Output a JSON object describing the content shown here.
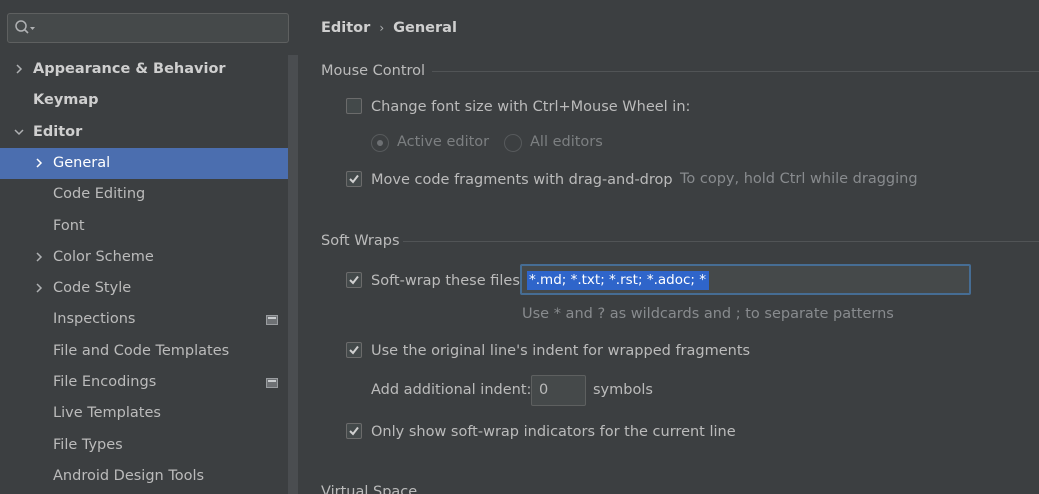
{
  "sidebar": {
    "search": {
      "value": "",
      "placeholder": ""
    },
    "items": [
      {
        "label": "Appearance & Behavior",
        "level": 0,
        "bold": true,
        "expandable": true,
        "expanded": false
      },
      {
        "label": "Keymap",
        "level": 0,
        "bold": true,
        "expandable": false
      },
      {
        "label": "Editor",
        "level": 0,
        "bold": true,
        "expandable": true,
        "expanded": true
      },
      {
        "label": "General",
        "level": 1,
        "expandable": true,
        "expanded": false,
        "selected": true
      },
      {
        "label": "Code Editing",
        "level": 1,
        "expandable": false
      },
      {
        "label": "Font",
        "level": 1,
        "expandable": false
      },
      {
        "label": "Color Scheme",
        "level": 1,
        "expandable": true,
        "expanded": false
      },
      {
        "label": "Code Style",
        "level": 1,
        "expandable": true,
        "expanded": false
      },
      {
        "label": "Inspections",
        "level": 1,
        "expandable": false,
        "project_icon": true
      },
      {
        "label": "File and Code Templates",
        "level": 1,
        "expandable": false
      },
      {
        "label": "File Encodings",
        "level": 1,
        "expandable": false,
        "project_icon": true
      },
      {
        "label": "Live Templates",
        "level": 1,
        "expandable": false
      },
      {
        "label": "File Types",
        "level": 1,
        "expandable": false
      },
      {
        "label": "Android Design Tools",
        "level": 1,
        "expandable": false
      }
    ]
  },
  "breadcrumb": {
    "parent": "Editor",
    "separator": "›",
    "current": "General"
  },
  "mouse_control": {
    "title": "Mouse Control",
    "change_font_size": {
      "label": "Change font size with Ctrl+Mouse Wheel in:",
      "checked": false
    },
    "active_editor": {
      "label": "Active editor",
      "selected": true,
      "enabled": false
    },
    "all_editors": {
      "label": "All editors",
      "selected": false,
      "enabled": false
    },
    "move_fragments": {
      "label": "Move code fragments with drag-and-drop",
      "checked": true
    },
    "move_hint": "To copy, hold Ctrl while dragging"
  },
  "soft_wraps": {
    "title": "Soft Wraps",
    "soft_wrap_files": {
      "label": "Soft-wrap these files:",
      "checked": true,
      "value": "*.md; *.txt; *.rst; *.adoc; *"
    },
    "wildcard_hint": "Use * and ? as wildcards and ; to separate patterns",
    "original_indent": {
      "label": "Use the original line's indent for wrapped fragments",
      "checked": true
    },
    "additional_indent": {
      "label": "Add additional indent:",
      "value": "0",
      "unit": "symbols"
    },
    "only_current_line": {
      "label": "Only show soft-wrap indicators for the current line",
      "checked": true
    }
  },
  "virtual_space": {
    "title": "Virtual Space"
  },
  "colors": {
    "selection": "#4b6eaf",
    "background": "#3c3f41",
    "field_focus": "#466d94",
    "text_selection": "#2f65ca"
  }
}
